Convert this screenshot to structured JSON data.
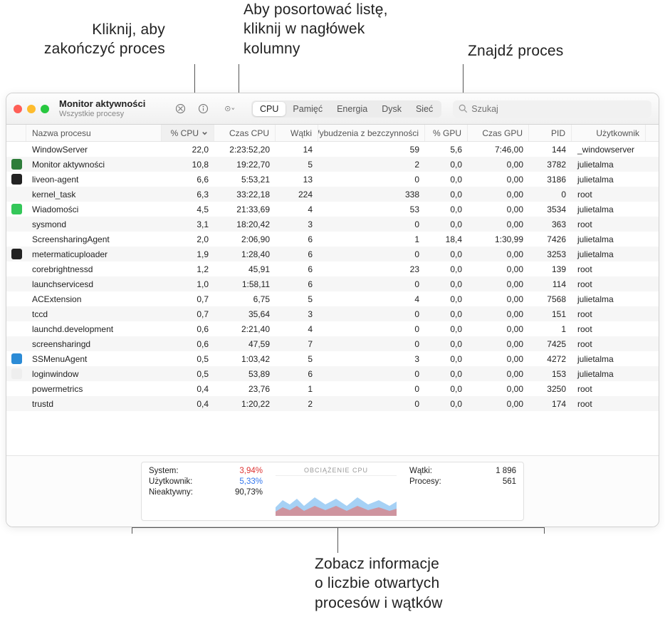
{
  "callouts": {
    "quit": "Kliknij, aby\nzakończyć proces",
    "sort": "Aby posortować listę,\nkliknij w nagłówek\nkolumny",
    "find": "Znajdź proces",
    "footer": "Zobacz informacje\no liczbie otwartych\nprocesów i wątków"
  },
  "window": {
    "title": "Monitor aktywności",
    "subtitle": "Wszystkie procesy"
  },
  "tabs": [
    "CPU",
    "Pamięć",
    "Energia",
    "Dysk",
    "Sieć"
  ],
  "active_tab": "CPU",
  "search": {
    "placeholder": "Szukaj"
  },
  "columns": [
    "",
    "Nazwa procesu",
    "% CPU",
    "Czas CPU",
    "Wątki",
    "Wybudzenia z bezczynności",
    "% GPU",
    "Czas GPU",
    "PID",
    "Użytkownik"
  ],
  "sorted_col": "% CPU",
  "rows": [
    {
      "icon": "",
      "name": "WindowServer",
      "cpu": "22,0",
      "cputime": "2:23:52,20",
      "threads": "14",
      "idle": "59",
      "gpu": "5,6",
      "gputime": "7:46,00",
      "pid": "144",
      "user": "_windowserver"
    },
    {
      "icon": "#2e7d3a",
      "name": "Monitor aktywności",
      "cpu": "10,8",
      "cputime": "19:22,70",
      "threads": "5",
      "idle": "2",
      "gpu": "0,0",
      "gputime": "0,00",
      "pid": "3782",
      "user": "julietalma"
    },
    {
      "icon": "#222",
      "name": "liveon-agent",
      "cpu": "6,6",
      "cputime": "5:53,21",
      "threads": "13",
      "idle": "0",
      "gpu": "0,0",
      "gputime": "0,00",
      "pid": "3186",
      "user": "julietalma"
    },
    {
      "icon": "",
      "name": "kernel_task",
      "cpu": "6,3",
      "cputime": "33:22,18",
      "threads": "224",
      "idle": "338",
      "gpu": "0,0",
      "gputime": "0,00",
      "pid": "0",
      "user": "root"
    },
    {
      "icon": "#34c759",
      "name": "Wiadomości",
      "cpu": "4,5",
      "cputime": "21:33,69",
      "threads": "4",
      "idle": "53",
      "gpu": "0,0",
      "gputime": "0,00",
      "pid": "3534",
      "user": "julietalma"
    },
    {
      "icon": "",
      "name": "sysmond",
      "cpu": "3,1",
      "cputime": "18:20,42",
      "threads": "3",
      "idle": "0",
      "gpu": "0,0",
      "gputime": "0,00",
      "pid": "363",
      "user": "root"
    },
    {
      "icon": "",
      "name": "ScreensharingAgent",
      "cpu": "2,0",
      "cputime": "2:06,90",
      "threads": "6",
      "idle": "1",
      "gpu": "18,4",
      "gputime": "1:30,99",
      "pid": "7426",
      "user": "julietalma"
    },
    {
      "icon": "#222",
      "name": "metermaticuploader",
      "cpu": "1,9",
      "cputime": "1:28,40",
      "threads": "6",
      "idle": "0",
      "gpu": "0,0",
      "gputime": "0,00",
      "pid": "3253",
      "user": "julietalma"
    },
    {
      "icon": "",
      "name": "corebrightnessd",
      "cpu": "1,2",
      "cputime": "45,91",
      "threads": "6",
      "idle": "23",
      "gpu": "0,0",
      "gputime": "0,00",
      "pid": "139",
      "user": "root"
    },
    {
      "icon": "",
      "name": "launchservicesd",
      "cpu": "1,0",
      "cputime": "1:58,11",
      "threads": "6",
      "idle": "0",
      "gpu": "0,0",
      "gputime": "0,00",
      "pid": "114",
      "user": "root"
    },
    {
      "icon": "",
      "name": "ACExtension",
      "cpu": "0,7",
      "cputime": "6,75",
      "threads": "5",
      "idle": "4",
      "gpu": "0,0",
      "gputime": "0,00",
      "pid": "7568",
      "user": "julietalma"
    },
    {
      "icon": "",
      "name": "tccd",
      "cpu": "0,7",
      "cputime": "35,64",
      "threads": "3",
      "idle": "0",
      "gpu": "0,0",
      "gputime": "0,00",
      "pid": "151",
      "user": "root"
    },
    {
      "icon": "",
      "name": "launchd.development",
      "cpu": "0,6",
      "cputime": "2:21,40",
      "threads": "4",
      "idle": "0",
      "gpu": "0,0",
      "gputime": "0,00",
      "pid": "1",
      "user": "root"
    },
    {
      "icon": "",
      "name": "screensharingd",
      "cpu": "0,6",
      "cputime": "47,59",
      "threads": "7",
      "idle": "0",
      "gpu": "0,0",
      "gputime": "0,00",
      "pid": "7425",
      "user": "root"
    },
    {
      "icon": "#2b8bd6",
      "name": "SSMenuAgent",
      "cpu": "0,5",
      "cputime": "1:03,42",
      "threads": "5",
      "idle": "3",
      "gpu": "0,0",
      "gputime": "0,00",
      "pid": "4272",
      "user": "julietalma"
    },
    {
      "icon": "#eee",
      "name": "loginwindow",
      "cpu": "0,5",
      "cputime": "53,89",
      "threads": "6",
      "idle": "0",
      "gpu": "0,0",
      "gputime": "0,00",
      "pid": "153",
      "user": "julietalma"
    },
    {
      "icon": "",
      "name": "powermetrics",
      "cpu": "0,4",
      "cputime": "23,76",
      "threads": "1",
      "idle": "0",
      "gpu": "0,0",
      "gputime": "0,00",
      "pid": "3250",
      "user": "root"
    },
    {
      "icon": "",
      "name": "trustd",
      "cpu": "0,4",
      "cputime": "1:20,22",
      "threads": "2",
      "idle": "0",
      "gpu": "0,0",
      "gputime": "0,00",
      "pid": "174",
      "user": "root"
    }
  ],
  "stats": {
    "system_label": "System:",
    "system_val": "3,94%",
    "user_label": "Użytkownik:",
    "user_val": "5,33%",
    "idle_label": "Nieaktywny:",
    "idle_val": "90,73%",
    "chart_title": "OBCIĄŻENIE CPU",
    "threads_label": "Wątki:",
    "threads_val": "1 896",
    "procs_label": "Procesy:",
    "procs_val": "561"
  }
}
